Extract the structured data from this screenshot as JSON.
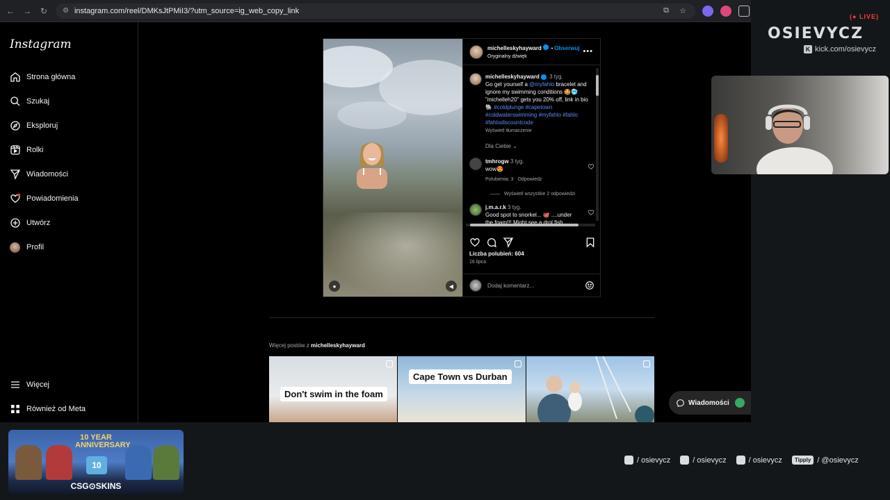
{
  "browser": {
    "url": "instagram.com/reel/DMKsJtPMiI3/?utm_source=ig_web_copy_link"
  },
  "sidebar": {
    "logo": "Instagram",
    "items": [
      {
        "label": "Strona główna",
        "icon": "home-icon"
      },
      {
        "label": "Szukaj",
        "icon": "search-icon"
      },
      {
        "label": "Eksploruj",
        "icon": "compass-icon"
      },
      {
        "label": "Rolki",
        "icon": "reels-icon"
      },
      {
        "label": "Wiadomości",
        "icon": "send-icon"
      },
      {
        "label": "Powiadomienia",
        "icon": "heart-icon"
      },
      {
        "label": "Utwórz",
        "icon": "plus-icon"
      },
      {
        "label": "Profil",
        "icon": "avatar"
      }
    ],
    "more": "Więcej",
    "meta": "Również od Meta"
  },
  "post": {
    "username": "michelleskyhayward",
    "follow": "Obserwuj",
    "audio": "Oryginalny dźwięk",
    "caption": {
      "username": "michelleskyhayward",
      "time": "3 tyg.",
      "text_1": "Go get yourself a",
      "mention": "@myfahlo",
      "text_2": "bracelet and ignore my swimming conditions 🤩🥶 \"michelleh20\" gets you 20% off, link in bio 🐘",
      "hashtags": "#coldplunge #capetown #coldwaterswimming #myfahlo #fahlo #fahlodiscountcode",
      "translate": "Wyświetl tłumaczenie"
    },
    "filter": "Dla Ciebie",
    "comments": [
      {
        "username": "tmhrogw",
        "time": "3 tyg.",
        "text": "wow😍",
        "likes": "Polubienia: 3",
        "reply": "Odpowiedz",
        "view_replies": "Wyświetl wszystkie 2 odpowiedzi"
      },
      {
        "username": "j.m.a.r.k",
        "time": "3 tyg.",
        "text": "Good spot to snorkel... 🐙 ....under the foam!!! Might see a drol fish"
      }
    ],
    "likes": "Liczba polubień: 604",
    "date": "16 lipca",
    "comment_placeholder": "Dodaj komentarz..."
  },
  "more_posts": {
    "label": "Więcej postów z",
    "username": "michelleskyhayward",
    "tiles": [
      {
        "caption": "Don't swim in the foam"
      },
      {
        "caption": "Cape Town vs Durban"
      },
      {
        "caption": ""
      }
    ]
  },
  "messages_pill": "Wiadomości",
  "overlay": {
    "live": "LIVE",
    "brand": "OSIEVYCZ",
    "kick": "kick.com/osievycz",
    "banner_top": "10 YEAR ANNIVERSARY",
    "banner_cake": "10",
    "banner_bottom": "CSG⊙SKINS",
    "socials": [
      {
        "text": "/ osievycz",
        "icon": "instagram-icon"
      },
      {
        "text": "/ osievycz",
        "icon": "tiktok-icon"
      },
      {
        "text": "/ osievycz",
        "icon": "youtube-icon"
      },
      {
        "badge": "Tipply",
        "text": "/ @osievycz"
      }
    ]
  }
}
